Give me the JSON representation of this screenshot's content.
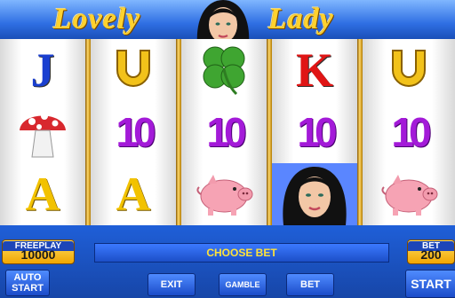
{
  "game": {
    "title_left": "Lovely",
    "title_right": "Lady"
  },
  "reels": [
    [
      "J",
      "mushroom",
      "A"
    ],
    [
      "horseshoe",
      "10",
      "A"
    ],
    [
      "clover",
      "10",
      "pig"
    ],
    [
      "K",
      "10",
      "lady"
    ],
    [
      "horseshoe",
      "10",
      "pig"
    ]
  ],
  "freeplay": {
    "label": "FREEPLAY",
    "value": "10000"
  },
  "bet": {
    "label": "BET",
    "value": "200"
  },
  "message": "CHOOSE BET",
  "buttons": {
    "auto_start": "AUTO\nSTART",
    "exit": "EXIT",
    "gamble": "GAMBLE",
    "bet": "BET",
    "start": "START"
  },
  "symbol_text": {
    "ten": "10"
  }
}
